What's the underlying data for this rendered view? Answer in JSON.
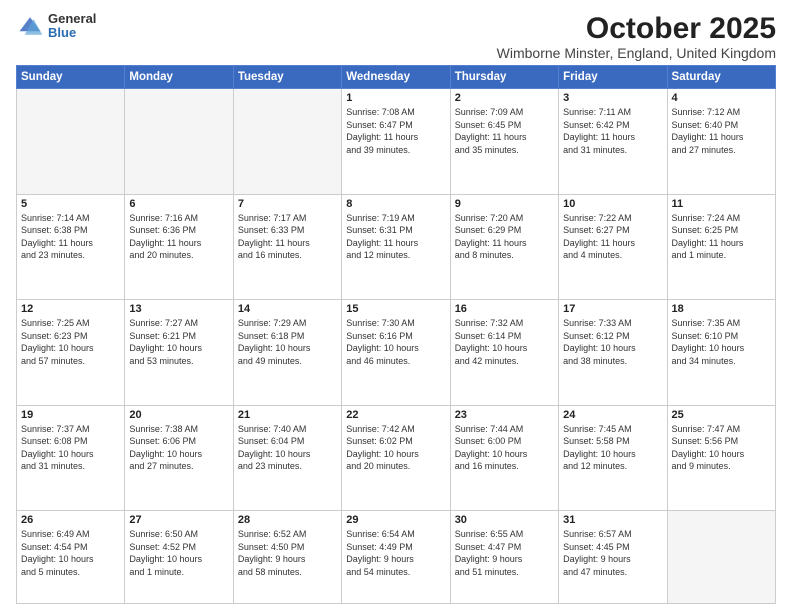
{
  "header": {
    "logo": {
      "general": "General",
      "blue": "Blue"
    },
    "month": "October 2025",
    "location": "Wimborne Minster, England, United Kingdom"
  },
  "weekdays": [
    "Sunday",
    "Monday",
    "Tuesday",
    "Wednesday",
    "Thursday",
    "Friday",
    "Saturday"
  ],
  "weeks": [
    [
      {
        "day": "",
        "info": ""
      },
      {
        "day": "",
        "info": ""
      },
      {
        "day": "",
        "info": ""
      },
      {
        "day": "1",
        "info": "Sunrise: 7:08 AM\nSunset: 6:47 PM\nDaylight: 11 hours\nand 39 minutes."
      },
      {
        "day": "2",
        "info": "Sunrise: 7:09 AM\nSunset: 6:45 PM\nDaylight: 11 hours\nand 35 minutes."
      },
      {
        "day": "3",
        "info": "Sunrise: 7:11 AM\nSunset: 6:42 PM\nDaylight: 11 hours\nand 31 minutes."
      },
      {
        "day": "4",
        "info": "Sunrise: 7:12 AM\nSunset: 6:40 PM\nDaylight: 11 hours\nand 27 minutes."
      }
    ],
    [
      {
        "day": "5",
        "info": "Sunrise: 7:14 AM\nSunset: 6:38 PM\nDaylight: 11 hours\nand 23 minutes."
      },
      {
        "day": "6",
        "info": "Sunrise: 7:16 AM\nSunset: 6:36 PM\nDaylight: 11 hours\nand 20 minutes."
      },
      {
        "day": "7",
        "info": "Sunrise: 7:17 AM\nSunset: 6:33 PM\nDaylight: 11 hours\nand 16 minutes."
      },
      {
        "day": "8",
        "info": "Sunrise: 7:19 AM\nSunset: 6:31 PM\nDaylight: 11 hours\nand 12 minutes."
      },
      {
        "day": "9",
        "info": "Sunrise: 7:20 AM\nSunset: 6:29 PM\nDaylight: 11 hours\nand 8 minutes."
      },
      {
        "day": "10",
        "info": "Sunrise: 7:22 AM\nSunset: 6:27 PM\nDaylight: 11 hours\nand 4 minutes."
      },
      {
        "day": "11",
        "info": "Sunrise: 7:24 AM\nSunset: 6:25 PM\nDaylight: 11 hours\nand 1 minute."
      }
    ],
    [
      {
        "day": "12",
        "info": "Sunrise: 7:25 AM\nSunset: 6:23 PM\nDaylight: 10 hours\nand 57 minutes."
      },
      {
        "day": "13",
        "info": "Sunrise: 7:27 AM\nSunset: 6:21 PM\nDaylight: 10 hours\nand 53 minutes."
      },
      {
        "day": "14",
        "info": "Sunrise: 7:29 AM\nSunset: 6:18 PM\nDaylight: 10 hours\nand 49 minutes."
      },
      {
        "day": "15",
        "info": "Sunrise: 7:30 AM\nSunset: 6:16 PM\nDaylight: 10 hours\nand 46 minutes."
      },
      {
        "day": "16",
        "info": "Sunrise: 7:32 AM\nSunset: 6:14 PM\nDaylight: 10 hours\nand 42 minutes."
      },
      {
        "day": "17",
        "info": "Sunrise: 7:33 AM\nSunset: 6:12 PM\nDaylight: 10 hours\nand 38 minutes."
      },
      {
        "day": "18",
        "info": "Sunrise: 7:35 AM\nSunset: 6:10 PM\nDaylight: 10 hours\nand 34 minutes."
      }
    ],
    [
      {
        "day": "19",
        "info": "Sunrise: 7:37 AM\nSunset: 6:08 PM\nDaylight: 10 hours\nand 31 minutes."
      },
      {
        "day": "20",
        "info": "Sunrise: 7:38 AM\nSunset: 6:06 PM\nDaylight: 10 hours\nand 27 minutes."
      },
      {
        "day": "21",
        "info": "Sunrise: 7:40 AM\nSunset: 6:04 PM\nDaylight: 10 hours\nand 23 minutes."
      },
      {
        "day": "22",
        "info": "Sunrise: 7:42 AM\nSunset: 6:02 PM\nDaylight: 10 hours\nand 20 minutes."
      },
      {
        "day": "23",
        "info": "Sunrise: 7:44 AM\nSunset: 6:00 PM\nDaylight: 10 hours\nand 16 minutes."
      },
      {
        "day": "24",
        "info": "Sunrise: 7:45 AM\nSunset: 5:58 PM\nDaylight: 10 hours\nand 12 minutes."
      },
      {
        "day": "25",
        "info": "Sunrise: 7:47 AM\nSunset: 5:56 PM\nDaylight: 10 hours\nand 9 minutes."
      }
    ],
    [
      {
        "day": "26",
        "info": "Sunrise: 6:49 AM\nSunset: 4:54 PM\nDaylight: 10 hours\nand 5 minutes."
      },
      {
        "day": "27",
        "info": "Sunrise: 6:50 AM\nSunset: 4:52 PM\nDaylight: 10 hours\nand 1 minute."
      },
      {
        "day": "28",
        "info": "Sunrise: 6:52 AM\nSunset: 4:50 PM\nDaylight: 9 hours\nand 58 minutes."
      },
      {
        "day": "29",
        "info": "Sunrise: 6:54 AM\nSunset: 4:49 PM\nDaylight: 9 hours\nand 54 minutes."
      },
      {
        "day": "30",
        "info": "Sunrise: 6:55 AM\nSunset: 4:47 PM\nDaylight: 9 hours\nand 51 minutes."
      },
      {
        "day": "31",
        "info": "Sunrise: 6:57 AM\nSunset: 4:45 PM\nDaylight: 9 hours\nand 47 minutes."
      },
      {
        "day": "",
        "info": ""
      }
    ]
  ]
}
